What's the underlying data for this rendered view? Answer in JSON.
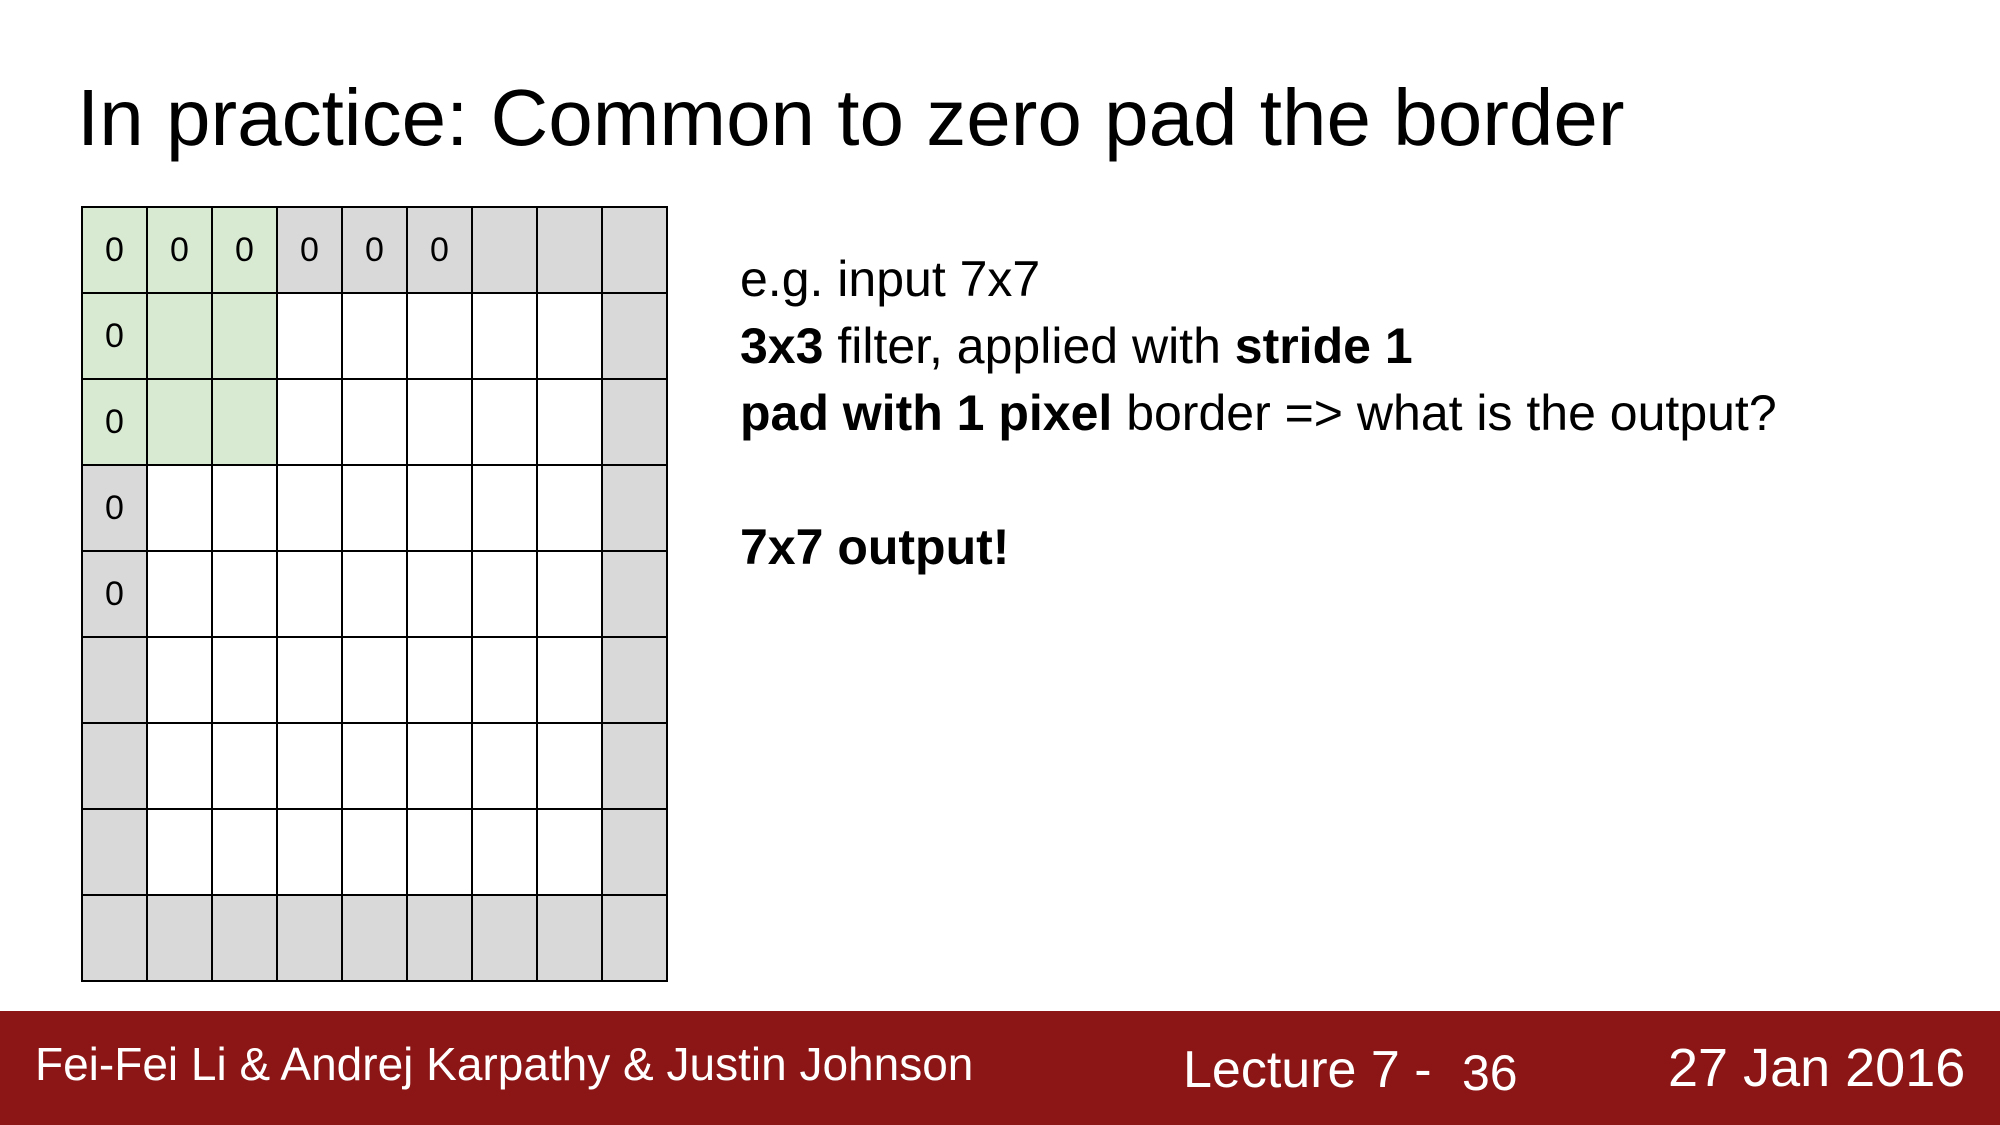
{
  "slide": {
    "title": "In practice: Common to zero pad the border"
  },
  "grid": {
    "rows": 9,
    "cols": 9,
    "zero_label": "0",
    "top_row_zero_count": 6,
    "left_col_zero_count": 5,
    "highlighted_filter_size": 3,
    "colors": {
      "padding": "#d9d9d9",
      "input": "#ffffff",
      "filter": "#d9ead3"
    }
  },
  "text": {
    "line1": "e.g. input 7x7",
    "line2_bold1": "3x3",
    "line2_text": " filter, applied with ",
    "line2_bold2": "stride 1",
    "line3_bold": "pad with 1 pixel",
    "line3_text": " border => what is the output?",
    "answer": "7x7 output!"
  },
  "footer": {
    "authors": "Fei-Fei Li & Andrej Karpathy & Justin Johnson",
    "lecture": "Lecture 7 -",
    "page": "36",
    "date": "27 Jan 2016",
    "background": "#8c1515"
  }
}
